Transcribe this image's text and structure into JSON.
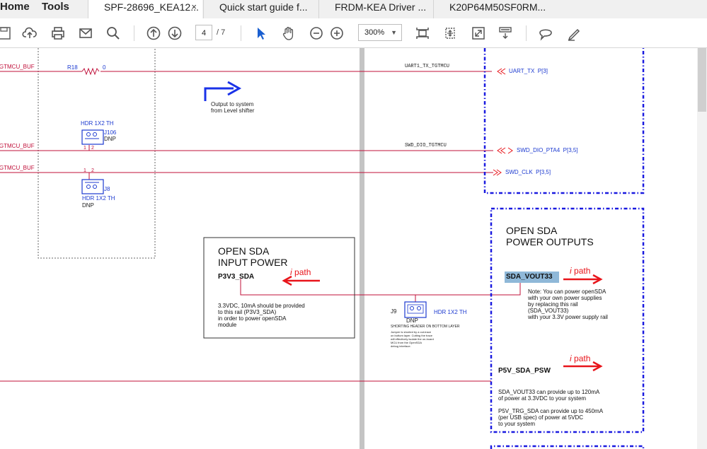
{
  "menu": {
    "home": "Home",
    "tools": "Tools"
  },
  "tabs": [
    {
      "label": "SPF-28696_KEA12...",
      "close": "×"
    },
    {
      "label": "Quick start guide f..."
    },
    {
      "label": "FRDM-KEA Driver ..."
    },
    {
      "label": "K20P64M50SF0RM..."
    }
  ],
  "toolbar": {
    "page_current": "4",
    "page_total": "/ 7",
    "zoom": "300%"
  },
  "schematic": {
    "net_tgtmcu_buf": "TGTMCU_BUF",
    "net_tgtmcu_buf2": "TGTMCU_BUF",
    "net_tgtmcu_buf3": "TGTMCU_BUF",
    "r18": "R18",
    "r18_val": "0",
    "uart_net": "UART1_TX_TGTMCU",
    "uart_port": "UART_TX",
    "uart_ref": "P[3]",
    "output_note": [
      "Output to system",
      "from Level shifter"
    ],
    "hdr1_name": "HDR 1X2 TH",
    "j106": "J106",
    "dnp": "DNP",
    "j8": "J8",
    "hdr2_name": "HDR 1X2 TH",
    "dnp2": "DNP",
    "pin1": "1",
    "pin2": "2",
    "swd_dio_net": "SWD_DIO_TGTMCU",
    "swd_dio_port": "SWD_DIO_PTA4",
    "swd_dio_ref": "P[3,5]",
    "swd_clk_port": "SWD_CLK",
    "swd_clk_ref": "P[3,5]",
    "input_title": [
      "OPEN SDA",
      "INPUT POWER"
    ],
    "p3v3": "P3V3_SDA",
    "ipath_i": "i",
    "ipath_label": "path",
    "input_note": [
      "3.3VDC, 10mA should be provided",
      "to this rail (P3V3_SDA)",
      "in order to power openSDA",
      "module"
    ],
    "j9": "J9",
    "j9_dnp": "DNP",
    "j9_hdr": "HDR 1X2 TH",
    "j9_layer": "SHORTING HEADER ON BOTTOM LAYER",
    "j9_note": [
      "Jumper is shorted by a cut-trace",
      "on bottom layer. Cutting the trace",
      "will effectively isolate the on-board",
      "MCU from the OpenSDA",
      "debug interface."
    ],
    "output_title": [
      "OPEN SDA",
      "POWER OUTPUTS"
    ],
    "sda_vout33": "SDA_VOUT33",
    "vout_note": [
      "Note: You can power openSDA",
      "with your own power supplies",
      "by replacing this rail",
      "(SDA_VOUT33)",
      "with your 3.3V power supply rail"
    ],
    "p5v": "P5V_SDA_PSW",
    "power_note1": [
      "SDA_VOUT33 can provide up to 120mA",
      "of power at 3.3VDC to your system"
    ],
    "power_note2": [
      "P5V_TRG_SDA can provide up to 450mA",
      "(per USB spec) of power at 5VDC",
      "to your system"
    ]
  },
  "colors": {
    "net_red": "#c0103a",
    "label_blue": "#1c3ad0",
    "dash_blue": "#1a1ae0",
    "arrow_red": "#e8141a"
  }
}
